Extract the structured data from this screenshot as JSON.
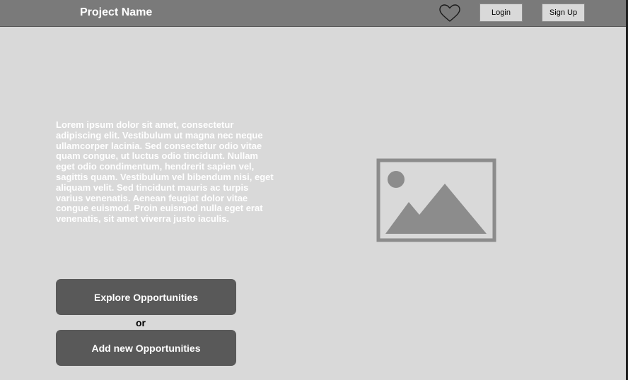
{
  "header": {
    "brand": "Project Name",
    "favorite_icon": "heart-icon",
    "login_label": "Login",
    "signup_label": "Sign Up"
  },
  "hero": {
    "description": "Lorem ipsum dolor sit amet, consectetur adipiscing elit. Vestibulum ut magna nec neque ullamcorper lacinia. Sed consectetur odio vitae quam congue, ut luctus odio tincidunt. Nullam eget odio condimentum, hendrerit sapien vel, sagittis quam. Vestibulum vel bibendum nisi, eget aliquam velit. Sed tincidunt mauris ac turpis varius venenatis. Aenean feugiat dolor vitae congue euismod. Proin euismod nulla eget erat venenatis, sit amet viverra justo iaculis.",
    "image_icon": "image-placeholder-icon"
  },
  "actions": {
    "explore_label": "Explore Opportunities",
    "separator": "or",
    "add_label": "Add new Opportunities"
  },
  "colors": {
    "background": "#d9d9d9",
    "navbar": "#7a7a7a",
    "button": "#595959",
    "placeholder": "#8c8c8c"
  }
}
